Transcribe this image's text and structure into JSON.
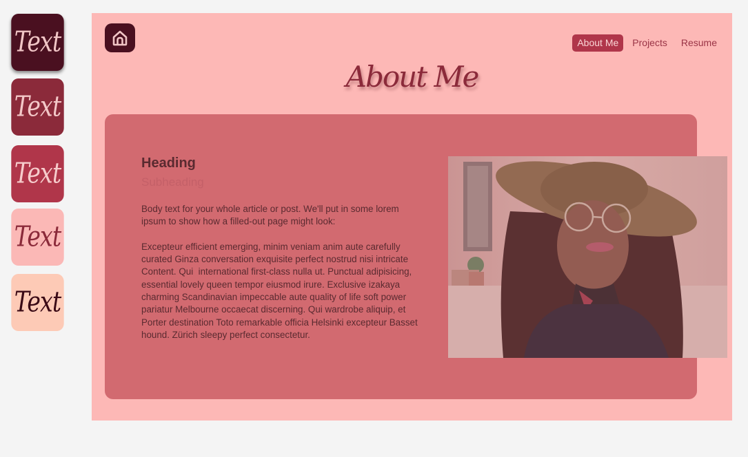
{
  "swatches": [
    {
      "label": "Text",
      "bg": "#4a1020",
      "fg": "#f1c6c6"
    },
    {
      "label": "Text",
      "bg": "#8b2a3a",
      "fg": "#f3c8c8"
    },
    {
      "label": "Text",
      "bg": "#b0364a",
      "fg": "#f6cccc"
    },
    {
      "label": "Text",
      "bg": "#fbb8b6",
      "fg": "#8b2a3a"
    },
    {
      "label": "Text",
      "bg": "#fdcab6",
      "fg": "#3a0a16"
    }
  ],
  "header": {
    "home_icon": "home-icon",
    "nav": [
      {
        "label": "About Me",
        "active": true
      },
      {
        "label": "Projects",
        "active": false
      },
      {
        "label": "Resume",
        "active": false
      }
    ]
  },
  "page": {
    "title": "About Me"
  },
  "article": {
    "heading": "Heading",
    "subheading": "Subheading",
    "body": "Body text for your whole article or post. We'll put in some lorem ipsum to show how a filled-out page might look:\n\nExcepteur efficient emerging, minim veniam anim aute carefully curated Ginza conversation exquisite perfect nostrud nisi intricate Content. Qui  international first-class nulla ut. Punctual adipisicing, essential lovely queen tempor eiusmod irure. Exclusive izakaya charming Scandinavian impeccable aute quality of life soft power pariatur Melbourne occaecat discerning. Qui wardrobe aliquip, et Porter destination Toto remarkable officia Helsinki excepteur Basset hound. Zürich sleepy perfect consectetur."
  },
  "colors": {
    "frame_bg": "#fdb8b6",
    "card_bg": "#d26a70",
    "accent": "#b0364a",
    "dark": "#4a1020"
  }
}
